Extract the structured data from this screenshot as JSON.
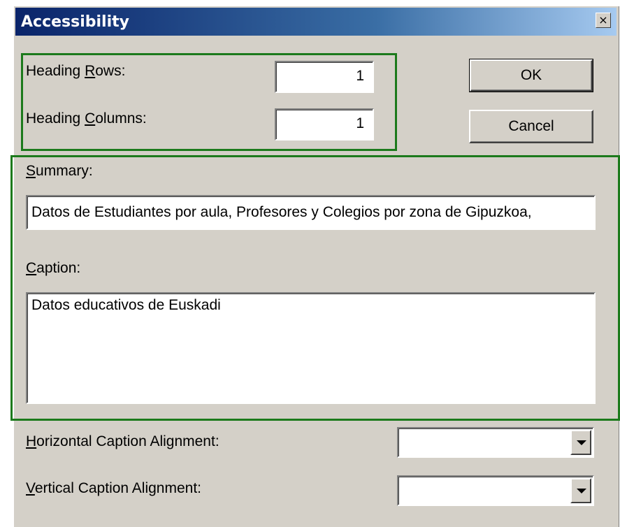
{
  "window": {
    "title": "Accessibility",
    "close_label": "×"
  },
  "heading": {
    "rows_label_pre": "Heading ",
    "rows_label_key": "R",
    "rows_label_post": "ows:",
    "rows_value": "1",
    "cols_label_pre": "Heading ",
    "cols_label_key": "C",
    "cols_label_post": "olumns:",
    "cols_value": "1"
  },
  "buttons": {
    "ok": "OK",
    "cancel": "Cancel"
  },
  "summary": {
    "label_key": "S",
    "label_post": "ummary:",
    "value": "Datos de Estudiantes por aula, Profesores y Colegios por zona de Gipuzkoa,"
  },
  "caption": {
    "label_key": "C",
    "label_post": "aption:",
    "value": "Datos educativos de Euskadi"
  },
  "alignment": {
    "horizontal_key": "H",
    "horizontal_post": "orizontal Caption Alignment:",
    "horizontal_value": "",
    "vertical_key": "V",
    "vertical_post": "ertical Caption Alignment:",
    "vertical_value": ""
  },
  "colors": {
    "highlight": "#1c7a1c",
    "dialog_bg": "#d4d0c8",
    "title_bar": "#0a246a"
  }
}
